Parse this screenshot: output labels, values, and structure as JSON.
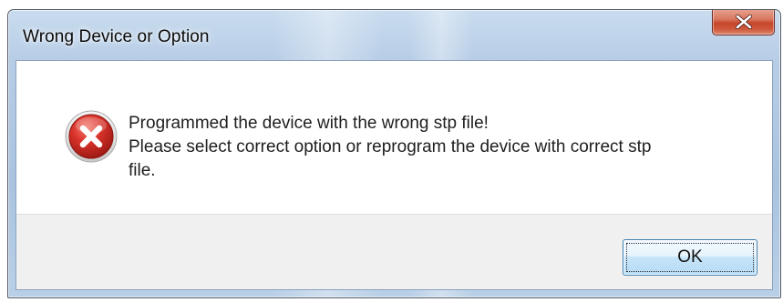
{
  "dialog": {
    "title": "Wrong Device or Option",
    "close_label": "x",
    "icon": "error-icon",
    "message_lines": [
      "Programmed the device with the wrong stp file!",
      "Please select correct option or reprogram the device with correct stp",
      "file."
    ],
    "ok_label": "OK"
  },
  "colors": {
    "close_button": "#c6462b",
    "error_icon": "#d32f2f",
    "footer_bg": "#f0f0f0",
    "ok_border": "#3c7fb1"
  }
}
